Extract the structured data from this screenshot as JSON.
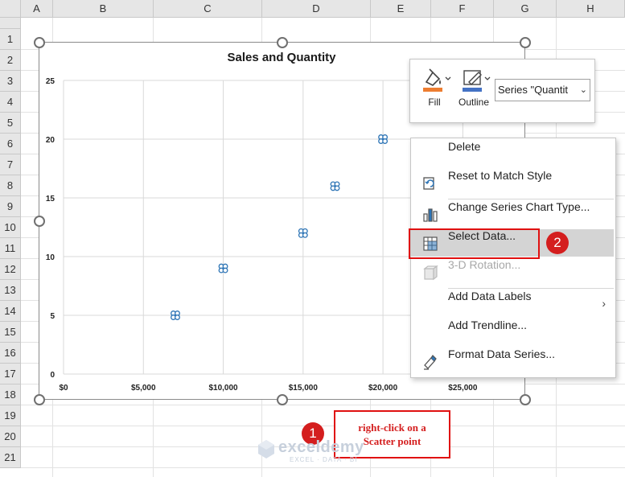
{
  "sheet": {
    "columns": [
      "A",
      "B",
      "C",
      "D",
      "E",
      "F",
      "G",
      "H"
    ],
    "rows": [
      "1",
      "2",
      "3",
      "4",
      "5",
      "6",
      "7",
      "8",
      "9",
      "10",
      "11",
      "12",
      "13",
      "14",
      "15",
      "16",
      "17",
      "18",
      "19",
      "20",
      "21"
    ]
  },
  "chart_data": {
    "type": "scatter",
    "title": "Sales and Quantity",
    "x": [
      7000,
      10000,
      15000,
      17000,
      20000
    ],
    "y": [
      5,
      9,
      12,
      16,
      20
    ],
    "xlim": [
      0,
      27500
    ],
    "ylim": [
      0,
      25
    ],
    "x_ticks": [
      0,
      5000,
      10000,
      15000,
      20000,
      25000
    ],
    "x_tick_labels": [
      "$0",
      "$5,000",
      "$10,000",
      "$15,000",
      "$20,000",
      "$25,000"
    ],
    "y_ticks": [
      0,
      5,
      10,
      15,
      20,
      25
    ],
    "y_tick_labels": [
      "0",
      "5",
      "10",
      "15",
      "20",
      "25"
    ],
    "grid": true,
    "marker_color": "#2e75b6"
  },
  "mini_toolbar": {
    "fill_label": "Fill",
    "outline_label": "Outline",
    "series_value": "Series \"Quantit",
    "fill_color": "#ed7d31",
    "outline_color": "#4472c4"
  },
  "context_menu": {
    "items": [
      {
        "label": "Delete",
        "icon": "none"
      },
      {
        "label": "Reset to Match Style",
        "icon": "reset-style-icon"
      },
      {
        "label": "Change Series Chart Type...",
        "icon": "bar-chart-icon"
      },
      {
        "label": "Select Data...",
        "icon": "select-data-icon"
      },
      {
        "label": "3-D Rotation...",
        "icon": "cube-icon"
      },
      {
        "label": "Add Data Labels",
        "icon": "none"
      },
      {
        "label": "Add Trendline...",
        "icon": "none"
      },
      {
        "label": "Format Data Series...",
        "icon": "format-series-icon"
      }
    ]
  },
  "annotations": {
    "step1_number": "1",
    "step2_number": "2",
    "callout_line1": "right-click on a",
    "callout_line2": "Scatter point",
    "accent_color": "#d41e1e"
  },
  "watermark": {
    "name": "exceldemy",
    "tagline": "EXCEL · DATA · BI"
  }
}
